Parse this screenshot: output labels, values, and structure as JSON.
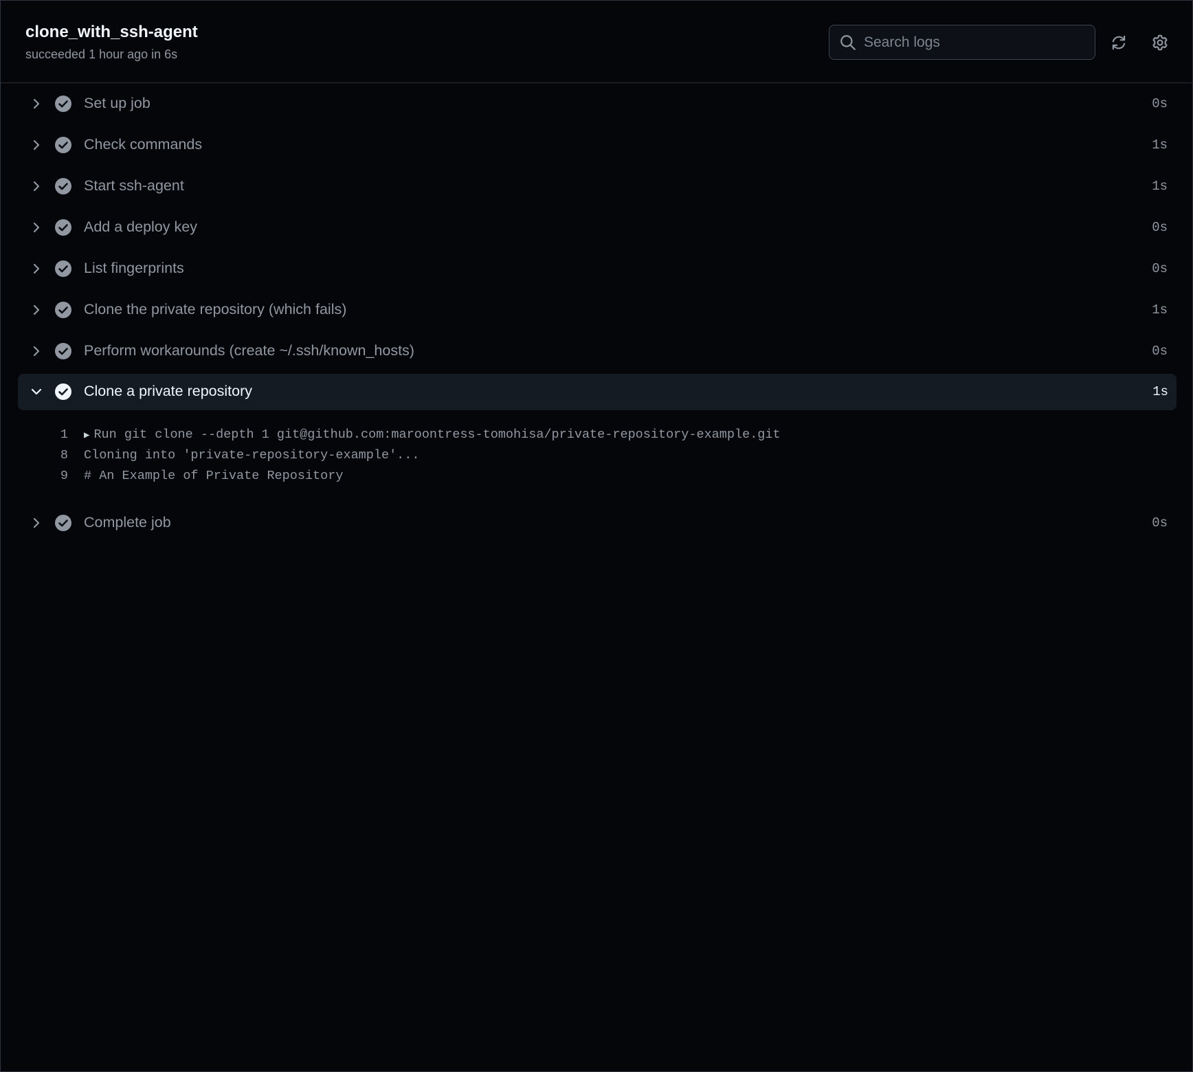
{
  "job": {
    "title": "clone_with_ssh-agent",
    "status": "succeeded 1 hour ago in 6s"
  },
  "search": {
    "placeholder": "Search logs",
    "value": ""
  },
  "icons": {
    "search": "search-icon",
    "refresh": "refresh-icon",
    "settings": "gear-icon",
    "step_status": "check-circle-icon"
  },
  "colors": {
    "background": "#04060a",
    "expanded_row": "#151b23",
    "text_muted": "#9198a1",
    "text_bright": "#f0f6fc"
  },
  "steps": [
    {
      "label": "Set up job",
      "duration": "0s"
    },
    {
      "label": "Check commands",
      "duration": "1s"
    },
    {
      "label": "Start ssh-agent",
      "duration": "1s"
    },
    {
      "label": "Add a deploy key",
      "duration": "0s"
    },
    {
      "label": "List fingerprints",
      "duration": "0s"
    },
    {
      "label": "Clone the private repository (which fails)",
      "duration": "1s"
    },
    {
      "label": "Perform workarounds (create ~/.ssh/known_hosts)",
      "duration": "0s"
    },
    {
      "label": "Clone a private repository",
      "duration": "1s",
      "expanded": true
    },
    {
      "label": "Complete job",
      "duration": "0s"
    }
  ],
  "log": [
    {
      "num": "1",
      "text": "Run git clone --depth 1 git@github.com:maroontress-tomohisa/private-repository-example.git",
      "collapsible": true
    },
    {
      "num": "8",
      "text": "Cloning into 'private-repository-example'..."
    },
    {
      "num": "9",
      "text": "# An Example of Private Repository"
    }
  ]
}
